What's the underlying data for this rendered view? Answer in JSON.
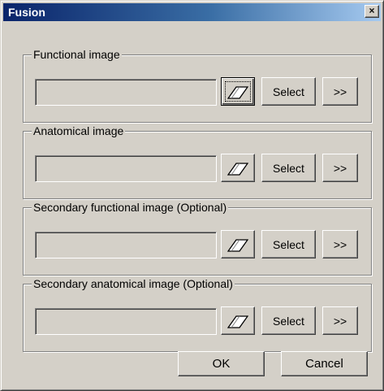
{
  "window": {
    "title": "Fusion",
    "close_glyph": "×"
  },
  "groups": [
    {
      "label": "Functional image",
      "value": "",
      "eraser_icon": "eraser-icon",
      "select_label": "Select",
      "more_label": ">>"
    },
    {
      "label": "Anatomical image",
      "value": "",
      "eraser_icon": "eraser-icon",
      "select_label": "Select",
      "more_label": ">>"
    },
    {
      "label": "Secondary functional image (Optional)",
      "value": "",
      "eraser_icon": "eraser-icon",
      "select_label": "Select",
      "more_label": ">>"
    },
    {
      "label": "Secondary anatomical image (Optional)",
      "value": "",
      "eraser_icon": "eraser-icon",
      "select_label": "Select",
      "more_label": ">>"
    }
  ],
  "footer": {
    "ok_label": "OK",
    "cancel_label": "Cancel"
  },
  "colors": {
    "dialog_face": "#d4d0c8",
    "title_gradient_start": "#0a246a",
    "title_gradient_end": "#a6caf0",
    "title_text": "#ffffff"
  }
}
